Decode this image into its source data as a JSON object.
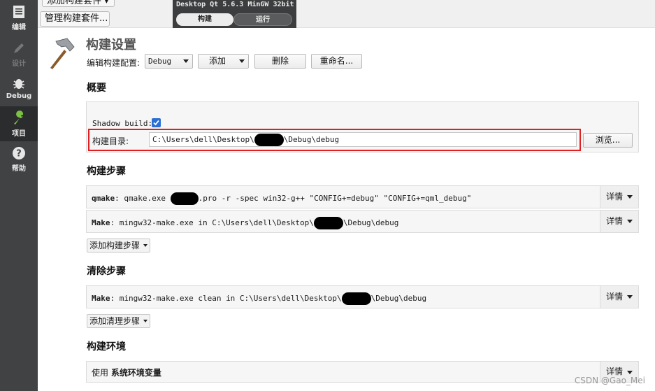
{
  "modebar": {
    "items": [
      {
        "label": "编辑",
        "icon": "edit-doc-icon",
        "state": "normal"
      },
      {
        "label": "设计",
        "icon": "pencil-icon",
        "state": "disabled"
      },
      {
        "label": "Debug",
        "icon": "bug-icon",
        "state": "normal"
      },
      {
        "label": "项目",
        "icon": "wrench-icon",
        "state": "active"
      },
      {
        "label": "帮助",
        "icon": "help-icon",
        "state": "normal"
      }
    ]
  },
  "topbar": {
    "add_kit_label": "添加构建套件",
    "manage_kits_label": "管理构建套件...",
    "kit_name": "Desktop Qt 5.6.3 MinGW 32bit",
    "tabs": [
      "构建",
      "运行"
    ],
    "active_tab": "构建"
  },
  "build_settings": {
    "title": "构建设置",
    "edit_config_label": "编辑构建配置:",
    "config_value": "Debug",
    "add_label": "添加",
    "delete_label": "删除",
    "rename_label": "重命名..."
  },
  "overview": {
    "heading": "概要",
    "shadow_build_label": "Shadow build:",
    "shadow_build_checked": true,
    "build_dir_label": "构建目录:",
    "build_dir_prefix": "C:\\Users\\dell\\Desktop\\",
    "build_dir_suffix": "\\Debug\\debug",
    "browse_label": "浏览..."
  },
  "build_steps": {
    "heading": "构建步骤",
    "steps": [
      {
        "name": "qmake",
        "pre": ": qmake.exe ",
        "post": ".pro -r -spec win32-g++ \"CONFIG+=debug\" \"CONFIG+=qml_debug\""
      },
      {
        "name": "Make",
        "pre": ": mingw32-make.exe in C:\\Users\\dell\\Desktop\\",
        "post": "\\Debug\\debug"
      }
    ],
    "details_label": "详情",
    "add_step_label": "添加构建步骤"
  },
  "clean_steps": {
    "heading": "清除步骤",
    "steps": [
      {
        "name": "Make",
        "pre": ": mingw32-make.exe clean in C:\\Users\\dell\\Desktop\\",
        "post": "\\Debug\\debug"
      }
    ],
    "details_label": "详情",
    "add_step_label": "添加清理步骤"
  },
  "build_env": {
    "heading": "构建环境",
    "use_label": "使用",
    "env_name": "系统环境变量",
    "details_label": "详情"
  },
  "watermark": "CSDN @Gao_Mei",
  "colors": {
    "modebar_bg": "#404244",
    "active_mode_bg": "#2b2c2d",
    "highlight_border": "#e02020",
    "checkbox_blue": "#2a6fd6"
  }
}
